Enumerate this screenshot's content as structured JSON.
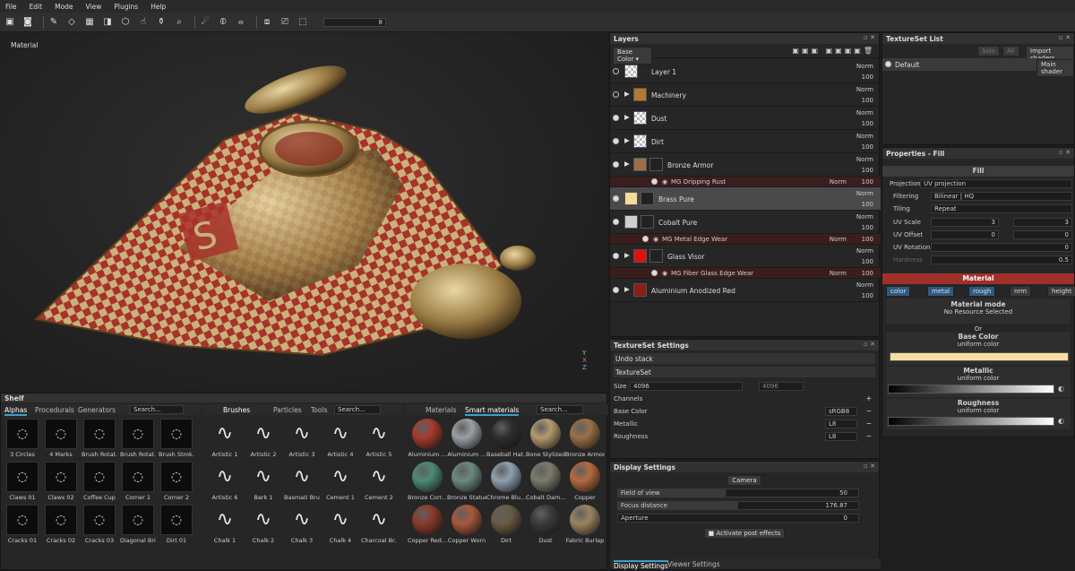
{
  "menu": [
    "File",
    "Edit",
    "Mode",
    "View",
    "Plugins",
    "Help"
  ],
  "toolbar": {
    "slider_value": "8"
  },
  "viewport": {
    "label": "Material",
    "axes": {
      "y": "Y",
      "x": "X",
      "z": "Z"
    }
  },
  "layers": {
    "title": "Layers",
    "channel": "Base Color",
    "rows": [
      {
        "name": "Layer 1",
        "blend": "Norm",
        "opacity": "100"
      },
      {
        "name": "Machinery",
        "blend": "Norm",
        "opacity": "100"
      },
      {
        "name": "Dust",
        "blend": "Norm",
        "opacity": "100"
      },
      {
        "name": "Dirt",
        "blend": "Norm",
        "opacity": "100"
      },
      {
        "name": "Bronze Armor",
        "blend": "Norm",
        "opacity": "100"
      },
      {
        "name": "Brass Pure",
        "blend": "Norm",
        "opacity": "100"
      },
      {
        "name": "Cobalt Pure",
        "blend": "Norm",
        "opacity": "100"
      },
      {
        "name": "Glass Visor",
        "blend": "Norm",
        "opacity": "100"
      },
      {
        "name": "Aluminium Anodized Red",
        "blend": "Norm",
        "opacity": "100"
      }
    ],
    "masks": [
      {
        "name": "MG Dripping Rust",
        "blend": "Norm",
        "opacity": "100"
      },
      {
        "name": "MG Metal Edge Wear",
        "blend": "Norm",
        "opacity": "100"
      },
      {
        "name": "MG Fiber Glass Edge Wear",
        "blend": "Norm",
        "opacity": "100"
      }
    ]
  },
  "textureset_list": {
    "title": "TextureSet List",
    "solo": "Solo",
    "all": "All",
    "import": "Import shaders",
    "item": "Default",
    "shader": "Main shader"
  },
  "properties": {
    "title": "Properties - Fill",
    "fill": "Fill",
    "projection_label": "Projection",
    "projection": "UV projection",
    "filtering_label": "Filtering",
    "filtering": "Bilinear | HQ",
    "tiling_label": "Tiling",
    "tiling": "Repeat",
    "uvscale_label": "UV Scale",
    "uvscale_a": "3",
    "uvscale_b": "3",
    "uvoffset_label": "UV Offset",
    "uvoffset_a": "0",
    "uvoffset_b": "0",
    "uvrot_label": "UV Rotation",
    "uvrot": "0",
    "hardness_label": "Hardness",
    "hardness": "0.5",
    "material": "Material",
    "chans": [
      "color",
      "metal",
      "rough",
      "nrm",
      "height"
    ],
    "mode_title": "Material mode",
    "mode_value": "No Resource Selected",
    "or": "Or",
    "base_title": "Base Color",
    "base_sub": "uniform color",
    "base_color": "#f7dfa3",
    "metal_title": "Metallic",
    "metal_sub": "uniform color",
    "rough_title": "Roughness",
    "rough_sub": "uniform color",
    "metal_ticks": [
      "0",
      "0.1",
      "0.2",
      "0.3",
      "0.4",
      "0.5",
      "0.6",
      "0.7",
      "0.8",
      "0.9"
    ]
  },
  "tset": {
    "title": "TextureSet Settings",
    "undo": "Undo stack",
    "ts": "TextureSet",
    "size_label": "Size",
    "size": "4096",
    "size2": "4096",
    "channels": "Channels",
    "rows": [
      {
        "name": "Base Color",
        "fmt": "sRGB8"
      },
      {
        "name": "Metallic",
        "fmt": "L8"
      },
      {
        "name": "Roughness",
        "fmt": "L8"
      }
    ]
  },
  "display": {
    "title": "Display Settings",
    "camera": "Camera",
    "fov_label": "Field of view",
    "fov": "50",
    "focus_label": "Focus distance",
    "focus": "176.87",
    "aperture_label": "Aperture",
    "aperture": "0",
    "post": "Activate post effects",
    "tab1": "Display Settings",
    "tab2": "Viewer Settings"
  },
  "shelf": {
    "title": "Shelf",
    "tabs_a": [
      "Alphas",
      "Procedurals",
      "Generators"
    ],
    "search": "Search...",
    "alphas": [
      "3 Circles",
      "4 Marks",
      "Brush Rotat...",
      "Brush Rotat...",
      "Brush Strok...",
      "Claws 01",
      "Claws 02",
      "Coffee Cup",
      "Corner 1",
      "Corner 2",
      "Cracks 01",
      "Cracks 02",
      "Cracks 03",
      "Diagonal Bri...",
      "Dirt 01"
    ],
    "tabs_b": [
      "Brushes",
      "Particles",
      "Tools"
    ],
    "brushes": [
      "Artistic 1",
      "Artistic 2",
      "Artistic 3",
      "Artistic 4",
      "Artistic 5",
      "Artistic 6",
      "Bark 1",
      "Basmati Brush",
      "Cement 1",
      "Cement 2",
      "Chalk 1",
      "Chalk 2",
      "Chalk 3",
      "Chalk 4",
      "Charcoal Br..."
    ],
    "tabs_c": [
      "Materials",
      "Smart materials"
    ],
    "materials": [
      {
        "name": "Aluminium ...",
        "color": "#a63a2e"
      },
      {
        "name": "Aluminium ...",
        "color": "#9aa0a6"
      },
      {
        "name": "Baseball Hat...",
        "color": "#2e2e2e"
      },
      {
        "name": "Bone Stylized",
        "color": "#b59a6e"
      },
      {
        "name": "Bronze Armor",
        "color": "#9a7048"
      },
      {
        "name": "Bronze Corr...",
        "color": "#4d8a78"
      },
      {
        "name": "Bronze Statue",
        "color": "#6a8a80"
      },
      {
        "name": "Chrome Blu...",
        "color": "#8fa0b0"
      },
      {
        "name": "Cobalt Dam...",
        "color": "#7c7a6c"
      },
      {
        "name": "Copper",
        "color": "#b56a40"
      },
      {
        "name": "Copper Red...",
        "color": "#8a3a2a"
      },
      {
        "name": "Copper Worn",
        "color": "#a8583a"
      },
      {
        "name": "Dirt",
        "color": "#6a5a44"
      },
      {
        "name": "Dust",
        "color": "#3a3a3a"
      },
      {
        "name": "Fabric Burlap",
        "color": "#9a8460"
      }
    ]
  }
}
